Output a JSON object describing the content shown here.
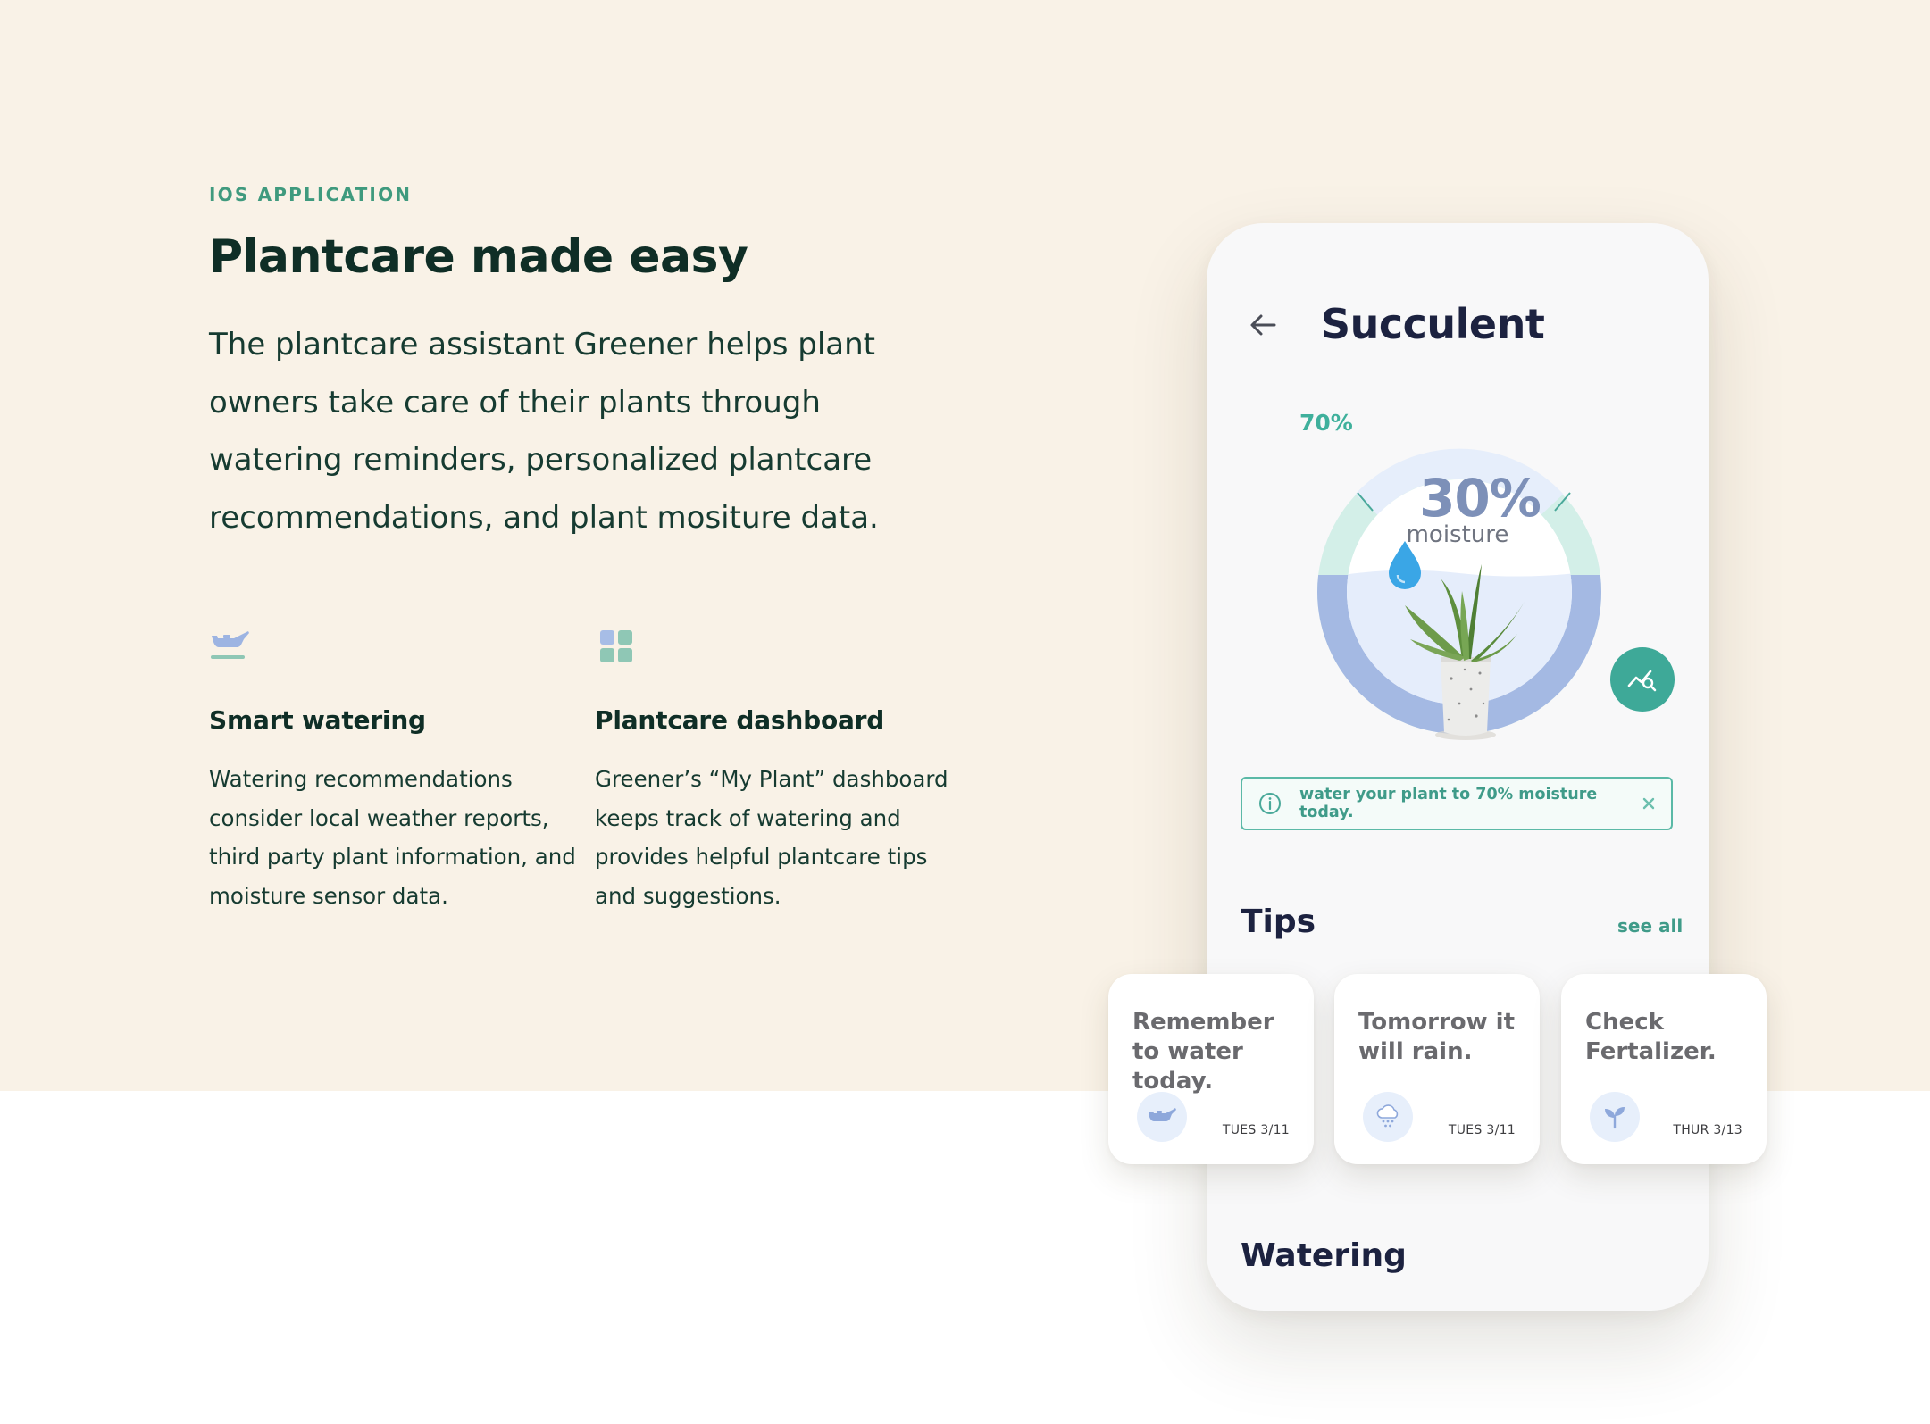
{
  "intro": {
    "eyebrow": "IOS APPLICATION",
    "headline": "Plantcare made easy",
    "lead": "The plantcare assistant Greener helps plant owners take care of their plants through watering reminders, personalized plantcare recommendations, and plant mositure data."
  },
  "features": [
    {
      "icon": "watering-can-icon",
      "title": "Smart watering",
      "body": "Watering recommendations consider local weather reports, third party plant information, and moisture sensor data."
    },
    {
      "icon": "dashboard-grid-icon",
      "title": "Plantcare dashboard",
      "body": "Greener’s “My Plant” dashboard keeps track of watering and provides helpful plantcare tips and suggestions."
    }
  ],
  "phone": {
    "title": "Succulent",
    "gauge": {
      "target_label": "70%",
      "target_fraction": 0.7,
      "current_value": "30%",
      "current_fraction": 0.3,
      "current_label": "moisture"
    },
    "banner": {
      "text": "water your plant to 70% moisture today."
    },
    "tips_title": "Tips",
    "see_all": "see all",
    "watering_title": "Watering"
  },
  "tips": [
    {
      "text": "Remember to water today.",
      "icon": "watering-can-icon",
      "date": "TUES 3/11"
    },
    {
      "text": "Tomorrow it will rain.",
      "icon": "rain-cloud-icon",
      "date": "TUES 3/11"
    },
    {
      "text": "Check Fertalizer.",
      "icon": "sprout-icon",
      "date": "THUR 3/13"
    }
  ],
  "colors": {
    "cream_background": "#f9f2e7",
    "accent_green": "#3f9a7e",
    "teal_button": "#3ea998",
    "gauge_target": "#d3efe8",
    "gauge_water": "#a4b9e3",
    "heading_navy": "#1c2240"
  }
}
